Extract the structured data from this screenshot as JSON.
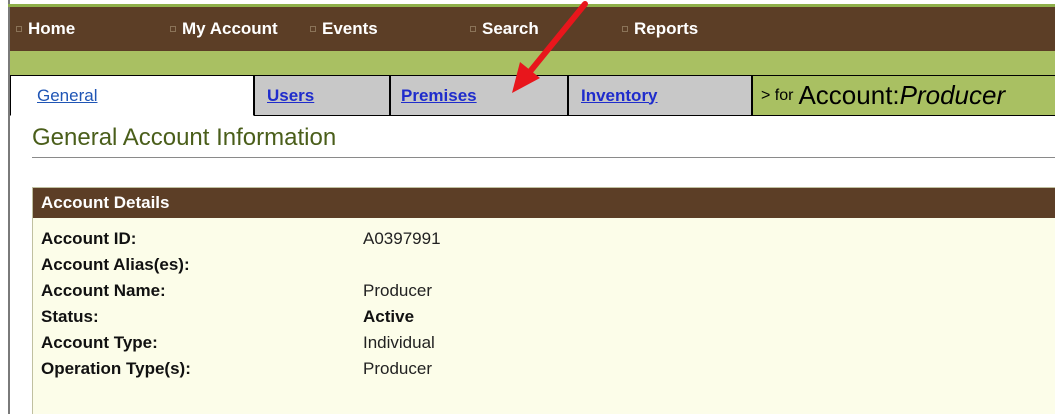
{
  "nav": {
    "items": [
      {
        "label": "Home"
      },
      {
        "label": "My Account"
      },
      {
        "label": "Events"
      },
      {
        "label": "Search"
      },
      {
        "label": "Reports"
      }
    ]
  },
  "tabs": {
    "items": [
      {
        "label": "General"
      },
      {
        "label": "Users"
      },
      {
        "label": "Premises"
      },
      {
        "label": "Inventory"
      }
    ],
    "for_prefix": "> for",
    "for_label": "Account:",
    "for_value": "Producer"
  },
  "page": {
    "title": "General Account Information"
  },
  "account_details": {
    "header": "Account Details",
    "rows": [
      {
        "label": "Account ID:",
        "value": "A0397991"
      },
      {
        "label": "Account Alias(es):",
        "value": ""
      },
      {
        "label": "Account Name:",
        "value": "Producer"
      },
      {
        "label": "Status:",
        "value": "Active"
      },
      {
        "label": "Account Type:",
        "value": "Individual"
      },
      {
        "label": "Operation Type(s):",
        "value": "Producer"
      }
    ]
  },
  "colors": {
    "nav_bg": "#5c3e26",
    "green_bar": "#a9c062",
    "title_green": "#4a5e1a",
    "panel_bg": "#fcfde9",
    "arrow_red": "#e8161c",
    "link_blue": "#1f2ccc"
  },
  "annotation": {
    "icon": "red-arrow-icon"
  }
}
